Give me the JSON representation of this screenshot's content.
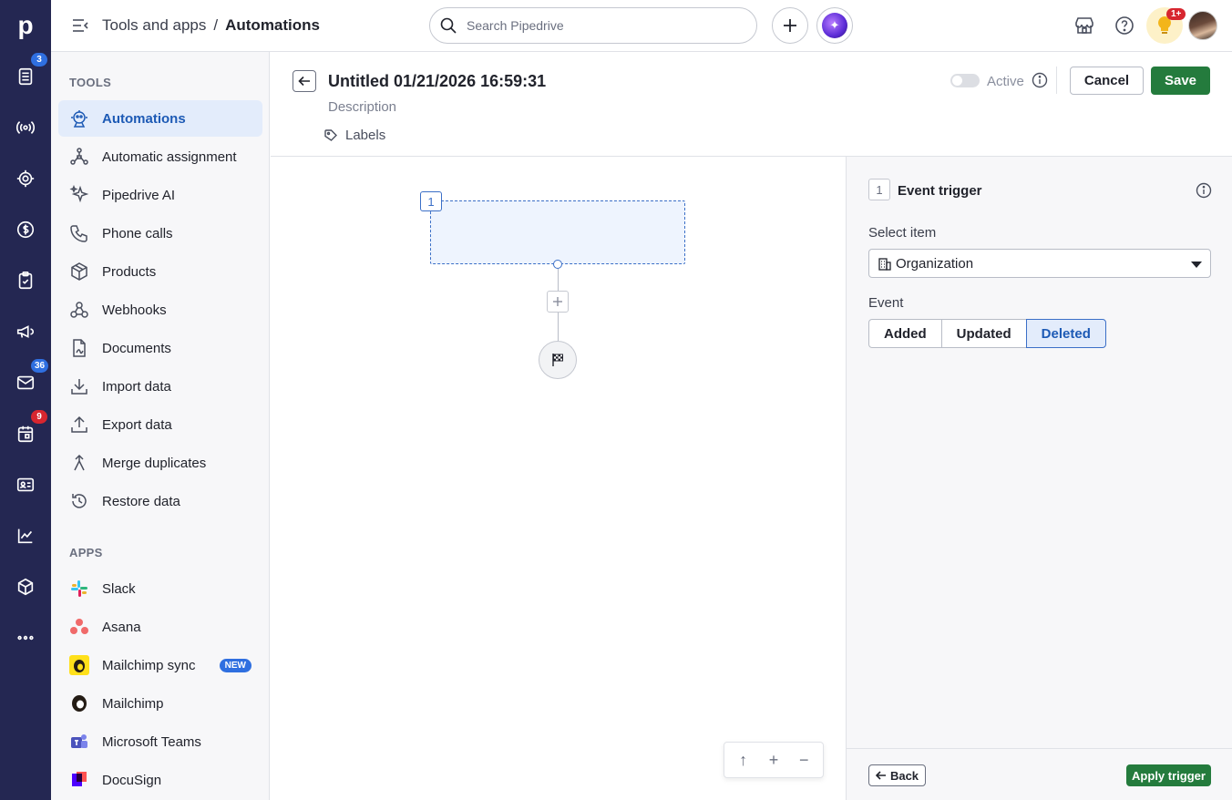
{
  "rail": {
    "logo": "p",
    "badges": {
      "leads": "3",
      "mail": "36",
      "activities": "9"
    },
    "colors": {
      "bg": "#242752",
      "badge_blue": "#2f6fe0",
      "badge_red": "#d7262f"
    }
  },
  "header": {
    "breadcrumb_parent": "Tools and apps",
    "breadcrumb_sep": "/",
    "breadcrumb_current": "Automations",
    "search_placeholder": "Search Pipedrive",
    "notifications_badge": "1+"
  },
  "nav": {
    "tools_heading": "TOOLS",
    "tools": [
      {
        "label": "Automations",
        "icon": "robot-icon",
        "active": true
      },
      {
        "label": "Automatic assignment",
        "icon": "assignment-icon"
      },
      {
        "label": "Pipedrive AI",
        "icon": "sparkle-icon"
      },
      {
        "label": "Phone calls",
        "icon": "phone-icon"
      },
      {
        "label": "Products",
        "icon": "box-icon"
      },
      {
        "label": "Webhooks",
        "icon": "webhook-icon"
      },
      {
        "label": "Documents",
        "icon": "document-icon"
      },
      {
        "label": "Import data",
        "icon": "import-icon"
      },
      {
        "label": "Export data",
        "icon": "export-icon"
      },
      {
        "label": "Merge duplicates",
        "icon": "merge-icon"
      },
      {
        "label": "Restore data",
        "icon": "restore-icon"
      }
    ],
    "apps_heading": "APPS",
    "apps": [
      {
        "label": "Slack",
        "icon": "slack-icon"
      },
      {
        "label": "Asana",
        "icon": "asana-icon"
      },
      {
        "label": "Mailchimp sync",
        "icon": "mailchimp-icon",
        "badge": "NEW"
      },
      {
        "label": "Mailchimp",
        "icon": "mailchimp-icon"
      },
      {
        "label": "Microsoft Teams",
        "icon": "teams-icon"
      },
      {
        "label": "DocuSign",
        "icon": "docusign-icon"
      }
    ]
  },
  "editor": {
    "title": "Untitled 01/21/2026 16:59:31",
    "description_placeholder": "Description",
    "labels": "Labels",
    "active_label": "Active",
    "active": false,
    "cancel_label": "Cancel",
    "save_label": "Save"
  },
  "canvas": {
    "step_number": "1"
  },
  "panel": {
    "step_number": "1",
    "title": "Event trigger",
    "select_item_label": "Select item",
    "select_item_value": "Organization",
    "event_label": "Event",
    "events": [
      {
        "label": "Added",
        "selected": false
      },
      {
        "label": "Updated",
        "selected": false
      },
      {
        "label": "Deleted",
        "selected": true
      }
    ],
    "back_label": "Back",
    "apply_label": "Apply trigger"
  },
  "colors": {
    "primary_green": "#247b3d",
    "accent_blue": "#1d5ab5",
    "active_bg": "#e3ecfb"
  }
}
